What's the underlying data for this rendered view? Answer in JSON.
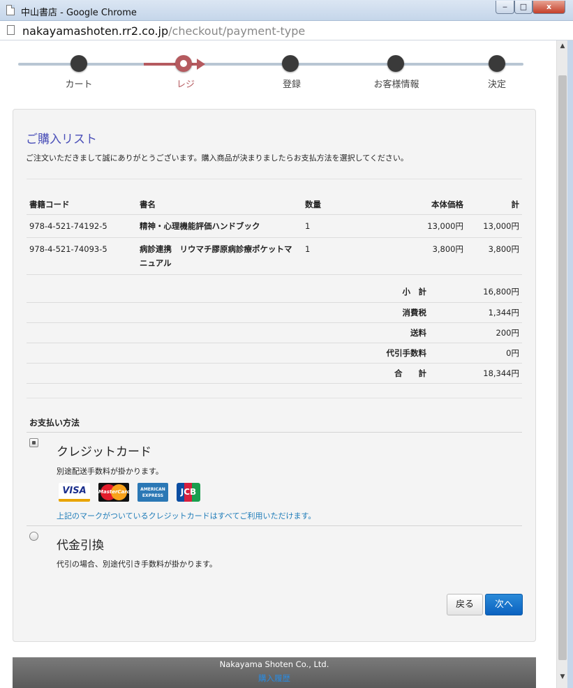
{
  "window": {
    "title": "中山書店 - Google Chrome",
    "min_glyph": "‒",
    "max_glyph": "□",
    "close_glyph": "x"
  },
  "address": {
    "domain": "nakayamashoten.rr2.co.jp",
    "path": "/checkout/payment-type"
  },
  "steps": [
    {
      "label": "カート",
      "active": false
    },
    {
      "label": "レジ",
      "active": true
    },
    {
      "label": "登録",
      "active": false
    },
    {
      "label": "お客様情報",
      "active": false
    },
    {
      "label": "決定",
      "active": false
    }
  ],
  "purchase": {
    "heading": "ご購入リスト",
    "intro": "ご注文いただきまして誠にありがとうございます。購入商品が決まりましたらお支払方法を選択してください。",
    "columns": {
      "code": "書籍コード",
      "name": "書名",
      "qty": "数量",
      "price": "本体価格",
      "total": "計"
    },
    "items": [
      {
        "code": "978-4-521-74192-5",
        "name": "精神・心理機能評価ハンドブック",
        "qty": "1",
        "price": "13,000円",
        "total": "13,000円"
      },
      {
        "code": "978-4-521-74093-5",
        "name": "病診連携　リウマチ膠原病診療ポケットマニュアル",
        "qty": "1",
        "price": "3,800円",
        "total": "3,800円"
      }
    ],
    "totals": [
      {
        "label": "小　計",
        "value": "16,800円"
      },
      {
        "label": "消費税",
        "value": "1,344円"
      },
      {
        "label": "送料",
        "value": "200円"
      },
      {
        "label": "代引手数料",
        "value": "0円"
      },
      {
        "label": "合　　計",
        "value": "18,344円"
      }
    ]
  },
  "payment": {
    "title": "お支払い方法",
    "credit": {
      "label": "クレジットカード",
      "note": "別途配送手数料が掛かります。",
      "cards_note": "上記のマークがついているクレジットカードはすべてご利用いただけます。",
      "checked": true
    },
    "cod": {
      "label": "代金引換",
      "note": "代引の場合、別途代引き手数料が掛かります。",
      "checked": false
    },
    "cards": {
      "visa": "VISA",
      "mastercard": "MasterCard",
      "amex_line1": "AMERICAN",
      "amex_line2": "EXPRESS",
      "jcb": "JCB"
    }
  },
  "buttons": {
    "back": "戻る",
    "next": "次へ"
  },
  "footer": {
    "company": "Nakayama Shoten Co., Ltd.",
    "link": "購入履歴"
  },
  "colors": {
    "step_active": "#b55a5f",
    "heading": "#4a4fb8",
    "link": "#1d7bb8",
    "primary_button": "#0b62c0"
  }
}
